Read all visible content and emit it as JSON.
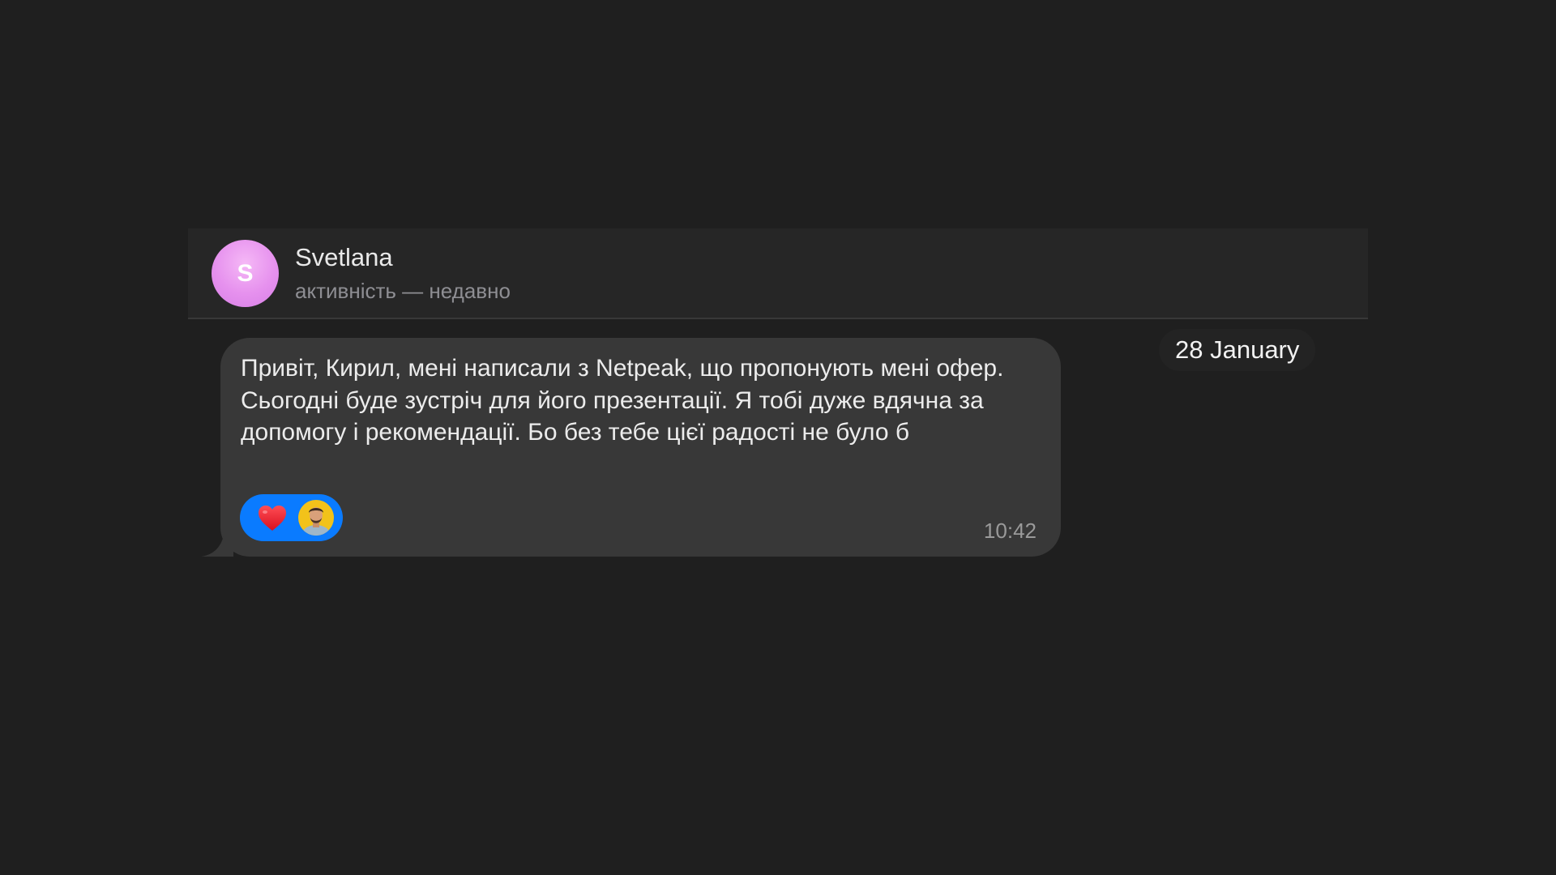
{
  "contact": {
    "initial": "S",
    "name": "Svetlana",
    "status": "активність — недавно"
  },
  "date_separator": "28 January",
  "message": {
    "text": "Привіт, Кирил, мені написали з Netpeak, що пропонують мені офер. Сьогодні буде зустріч для його презентації. Я тобі дуже вдячна за допомогу і рекомендації. Бо без тебе цієї радості не було б",
    "time": "10:42",
    "reaction": {
      "emoji_icon": "heart-icon",
      "reactor_icon": "user-avatar"
    }
  },
  "colors": {
    "background": "#1f1f1f",
    "header": "#262626",
    "bubble": "#383838",
    "reaction_pill": "#0a7bff",
    "avatar": "#e691ee",
    "heart": "#e8202e"
  }
}
